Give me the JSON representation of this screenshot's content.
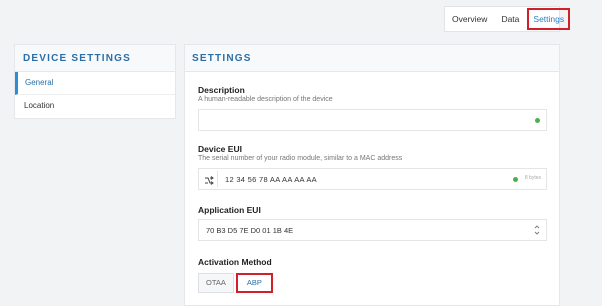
{
  "top_tabs": [
    "Overview",
    "Data",
    "Settings"
  ],
  "sidebar": {
    "title": "DEVICE SETTINGS",
    "items": [
      {
        "label": "General",
        "active": true
      },
      {
        "label": "Location",
        "active": false
      }
    ]
  },
  "settings": {
    "title": "SETTINGS",
    "description": {
      "label": "Description",
      "help": "A human-readable description of the device",
      "value": ""
    },
    "device_eui": {
      "label": "Device EUI",
      "help": "The serial number of your radio module, similar to a MAC address",
      "value": "12  34  56  78  AA  AA  AA  AA",
      "byte_count": "8 bytes"
    },
    "app_eui": {
      "label": "Application EUI",
      "value": "70 B3 D5 7E D0 01 1B 4E"
    },
    "activation": {
      "label": "Activation Method",
      "options": [
        "OTAA",
        "ABP"
      ],
      "selected": "ABP"
    }
  },
  "colors": {
    "accent": "#2a6fa8",
    "highlight": "#d0202a",
    "valid": "#4caf50"
  }
}
